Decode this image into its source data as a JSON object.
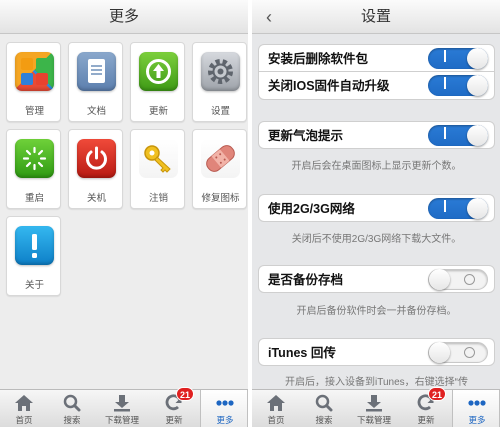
{
  "left_panel": {
    "title": "更多",
    "tiles": [
      {
        "label": "管理",
        "icon": "windows-manage-icon"
      },
      {
        "label": "文档",
        "icon": "document-icon"
      },
      {
        "label": "更新",
        "icon": "update-arrow-icon"
      },
      {
        "label": "设置",
        "icon": "gear-icon"
      },
      {
        "label": "重启",
        "icon": "restart-icon"
      },
      {
        "label": "关机",
        "icon": "power-icon"
      },
      {
        "label": "注销",
        "icon": "key-icon"
      },
      {
        "label": "修复图标",
        "icon": "bandage-icon"
      },
      {
        "label": "关于",
        "icon": "info-exclamation-icon"
      }
    ]
  },
  "right_panel": {
    "title": "设置",
    "back_glyph": "‹",
    "settings": [
      {
        "label": "安装后删除软件包",
        "on": true
      },
      {
        "label": "关闭IOS固件自动升级",
        "on": true
      },
      {
        "label": "更新气泡提示",
        "on": true,
        "note": "开启后会在桌面图标上显示更新个数。"
      },
      {
        "label": "使用2G/3G网络",
        "on": true,
        "note": "关闭后不使用2G/3G网络下载大文件。"
      },
      {
        "label": "是否备份存档",
        "on": false,
        "note": "开启后备份软件时会一并备份存档。"
      },
      {
        "label": "iTunes 回传",
        "on": false,
        "note": "开启后，接入设备到iTunes，右键选择“传"
      }
    ]
  },
  "tabbar": {
    "tabs": [
      {
        "label": "首页",
        "icon": "home-icon"
      },
      {
        "label": "搜索",
        "icon": "search-icon"
      },
      {
        "label": "下载管理",
        "icon": "download-icon"
      },
      {
        "label": "更新",
        "icon": "refresh-icon",
        "badge": "21"
      },
      {
        "label": "更多",
        "icon": "more-dots-icon",
        "active": true
      }
    ]
  },
  "colors": {
    "accent": "#1f6bc5",
    "badge": "#e02020",
    "switch_on": "#2a7bd6"
  }
}
